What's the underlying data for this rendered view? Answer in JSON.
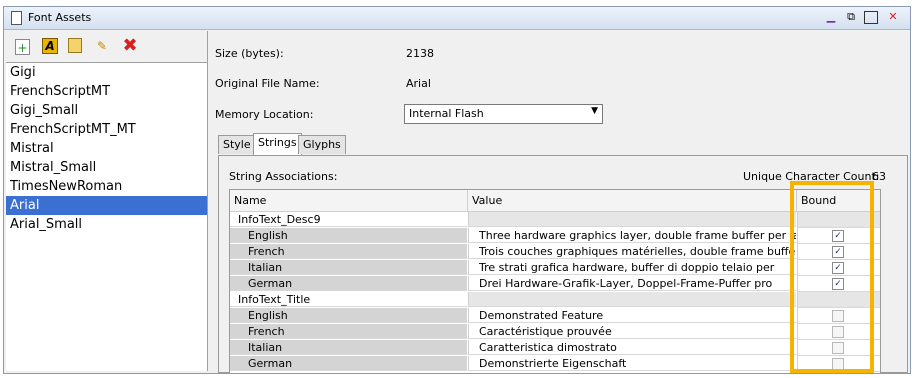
{
  "window": {
    "title": "Font Assets",
    "controls": [
      "minimize-icon",
      "dock-icon",
      "maximize-icon",
      "close-icon"
    ]
  },
  "toolbar": {
    "icons": [
      "add-font-icon",
      "font-properties-icon",
      "open-icon",
      "edit-icon",
      "delete-icon"
    ]
  },
  "fonts": [
    "Gigi",
    "FrenchScriptMT",
    "Gigi_Small",
    "FrenchScriptMT_MT",
    "Mistral",
    "Mistral_Small",
    "TimesNewRoman",
    "Arial",
    "Arial_Small"
  ],
  "selected_font_index": 7,
  "props": {
    "size_label": "Size (bytes):",
    "size_value": "2138",
    "file_label": "Original File Name:",
    "file_value": "Arial",
    "memory_label": "Memory Location:",
    "memory_value": "Internal Flash"
  },
  "tabs": [
    "Style",
    "Strings",
    "Glyphs"
  ],
  "active_tab": "Strings",
  "strings": {
    "assoc_label": "String Associations:",
    "unique_label": "Unique Character Count:",
    "unique_value": "63",
    "columns": [
      "Name",
      "Value",
      "Bound"
    ],
    "rows": [
      {
        "type": "group",
        "name": "InfoText_Desc9",
        "value": "",
        "bound": null
      },
      {
        "type": "child",
        "name": "English",
        "value": "Three hardware graphics layer, double frame buffer per layer",
        "bound": true
      },
      {
        "type": "child",
        "name": "French",
        "value": "Trois couches graphiques matérielles, double frame buffer par",
        "bound": true
      },
      {
        "type": "child",
        "name": "Italian",
        "value": "Tre strati grafica hardware, buffer di doppio telaio per",
        "bound": true
      },
      {
        "type": "child",
        "name": "German",
        "value": "Drei Hardware-Grafik-Layer, Doppel-Frame-Puffer pro",
        "bound": true
      },
      {
        "type": "group",
        "name": "InfoText_Title",
        "value": "",
        "bound": null
      },
      {
        "type": "child",
        "name": "English",
        "value": "Demonstrated Feature",
        "bound": false
      },
      {
        "type": "child",
        "name": "French",
        "value": "Caractéristique prouvée",
        "bound": false
      },
      {
        "type": "child",
        "name": "Italian",
        "value": "Caratteristica dimostrato",
        "bound": false
      },
      {
        "type": "child",
        "name": "German",
        "value": "Demonstrierte Eigenschaft",
        "bound": false
      }
    ]
  },
  "colors": {
    "selection": "#3b6fd1",
    "highlight": "#f5b400",
    "close": "#d92020",
    "minimize": "#7a2fa0"
  }
}
